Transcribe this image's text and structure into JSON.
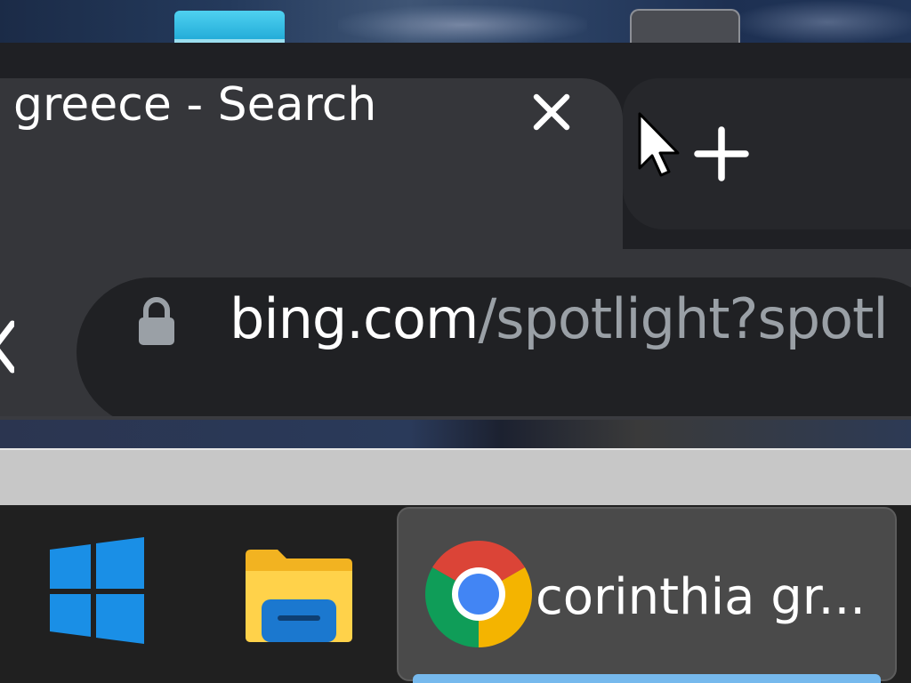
{
  "browser": {
    "active_tab": {
      "title": "greece - Search",
      "close_icon": "close-icon"
    },
    "new_tab_icon": "plus-icon",
    "address_bar": {
      "lock_icon": "lock-icon",
      "host": "bing.com",
      "path": "/spotlight?spotl"
    }
  },
  "taskbar": {
    "start_icon": "windows-logo-icon",
    "explorer_icon": "file-explorer-icon",
    "chrome_task": {
      "icon": "chrome-icon",
      "label": "corinthia gr..."
    },
    "accent_color": "#76b9ed"
  },
  "colors": {
    "tab_active": "#35363a",
    "tab_strip": "#1f2024",
    "omnibox": "#202124",
    "url_path": "#9aa0a6",
    "taskbar": "#202020"
  }
}
